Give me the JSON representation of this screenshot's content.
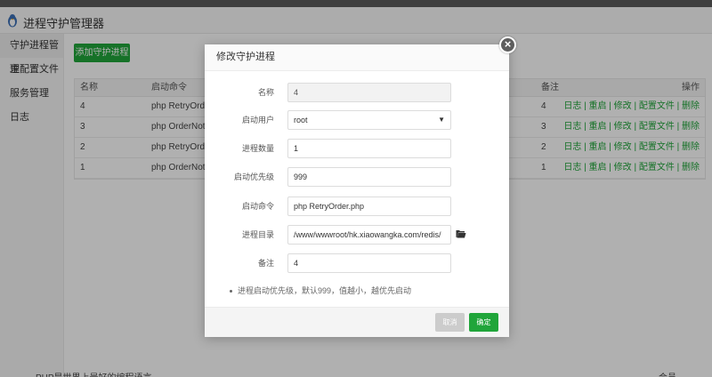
{
  "app": {
    "title": "进程守护管理器"
  },
  "sidebar": {
    "items": [
      {
        "label": "守护进程管理"
      },
      {
        "label": "主配置文件"
      },
      {
        "label": "服务管理"
      },
      {
        "label": "日志"
      }
    ]
  },
  "toolbar": {
    "add_label": "添加守护进程"
  },
  "table": {
    "headers": {
      "name": "名称",
      "command": "启动命令",
      "remark": "备注",
      "ops": "操作"
    },
    "rows": [
      {
        "name": "4",
        "command": "php RetryOrder.php",
        "remark": "4",
        "ops": "日志 | 重启 | 修改 | 配置文件 | 删除"
      },
      {
        "name": "3",
        "command": "php OrderNotify.php",
        "remark": "3",
        "ops": "日志 | 重启 | 修改 | 配置文件 | 删除"
      },
      {
        "name": "2",
        "command": "php RetryOrder.php",
        "remark": "2",
        "ops": "日志 | 重启 | 修改 | 配置文件 | 删除"
      },
      {
        "name": "1",
        "command": "php OrderNotify.php",
        "remark": "1",
        "ops": "日志 | 重启 | 修改 | 配置文件 | 删除"
      }
    ]
  },
  "footer": {
    "left": "PHP是世界上最好的编程语言",
    "right": "会员"
  },
  "modal": {
    "title": "修改守护进程",
    "fields": {
      "name": {
        "label": "名称",
        "value": "4"
      },
      "user": {
        "label": "启动用户",
        "value": "root"
      },
      "count": {
        "label": "进程数量",
        "value": "1"
      },
      "priority": {
        "label": "启动优先级",
        "value": "999"
      },
      "command": {
        "label": "启动命令",
        "value": "php RetryOrder.php"
      },
      "dir": {
        "label": "进程目录",
        "value": "/www/wwwroot/hk.xiaowangka.com/redis/"
      },
      "remark": {
        "label": "备注",
        "value": "4"
      }
    },
    "tip": "进程启动优先级，默认999，值越小，越优先启动",
    "cancel_label": "取消",
    "ok_label": "确定"
  },
  "colors": {
    "accent": "#20a53a",
    "overlay": "#000000"
  },
  "icons": {
    "close": "close-icon",
    "folder": "folder-open-icon",
    "logo": "penguin-logo-icon"
  }
}
